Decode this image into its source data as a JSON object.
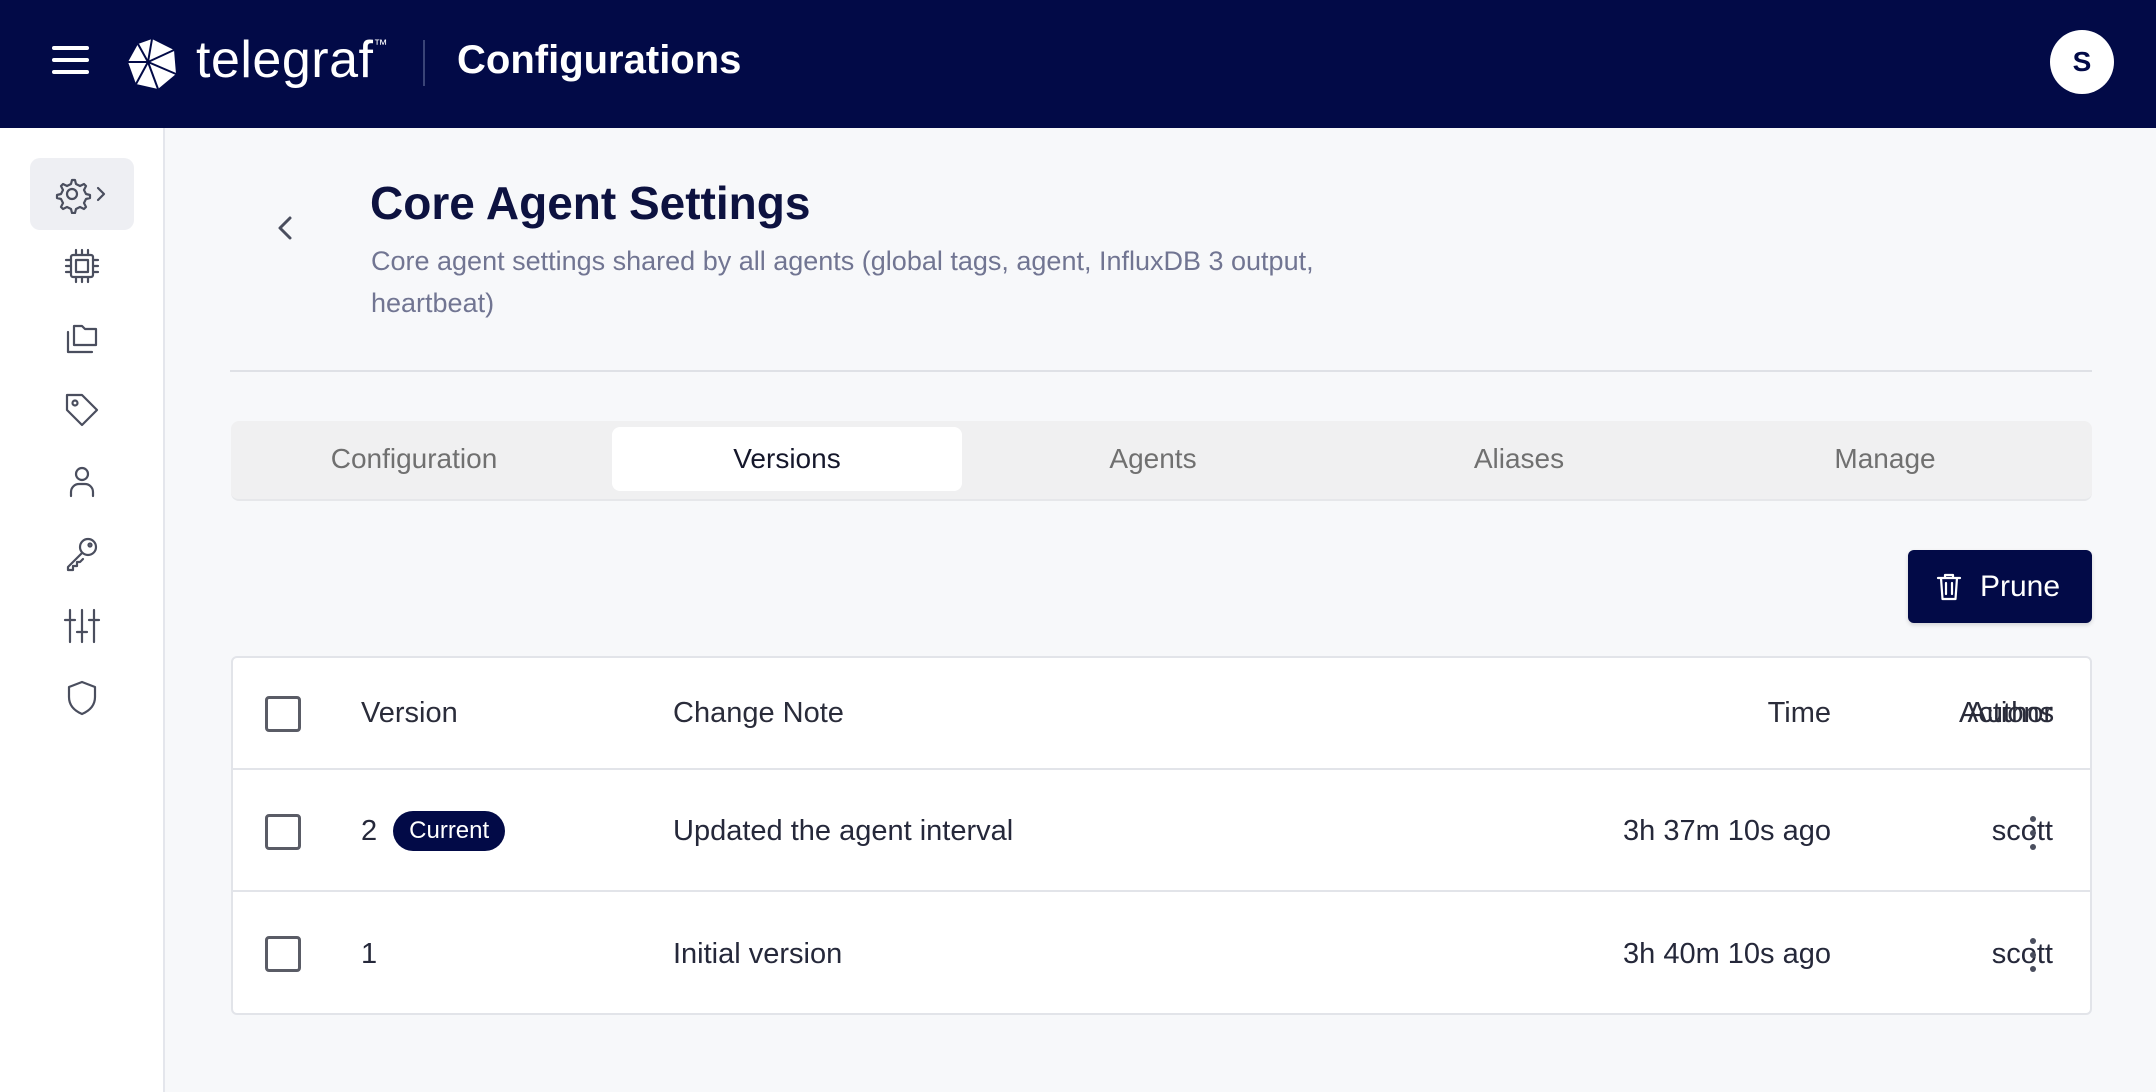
{
  "header": {
    "brand": "telegraf",
    "trademark": "™",
    "page_title": "Configurations",
    "avatar_initial": "S"
  },
  "sidebar": {
    "items": [
      {
        "icon": "settings-gear-icon",
        "active": true
      },
      {
        "icon": "chip-icon"
      },
      {
        "icon": "folders-icon"
      },
      {
        "icon": "tag-icon"
      },
      {
        "icon": "user-icon"
      },
      {
        "icon": "key-icon"
      },
      {
        "icon": "sliders-icon"
      },
      {
        "icon": "shield-icon"
      }
    ]
  },
  "page": {
    "title": "Core Agent Settings",
    "description": "Core agent settings shared by all agents (global tags, agent, InfluxDB 3 output, heartbeat)"
  },
  "tabs": [
    "Configuration",
    "Versions",
    "Agents",
    "Aliases",
    "Manage"
  ],
  "active_tab": "Versions",
  "prune_label": "Prune",
  "table": {
    "headers": {
      "version": "Version",
      "change_note": "Change Note",
      "time": "Time",
      "author": "Author",
      "actions": "Actions"
    },
    "rows": [
      {
        "version": "2",
        "badge": "Current",
        "change_note": "Updated the agent interval",
        "time": "3h 37m 10s ago",
        "author": "scott"
      },
      {
        "version": "1",
        "badge": "",
        "change_note": "Initial version",
        "time": "3h 40m 10s ago",
        "author": "scott"
      }
    ]
  },
  "colors": {
    "navy": "#020a47",
    "muted_text": "#717592"
  }
}
